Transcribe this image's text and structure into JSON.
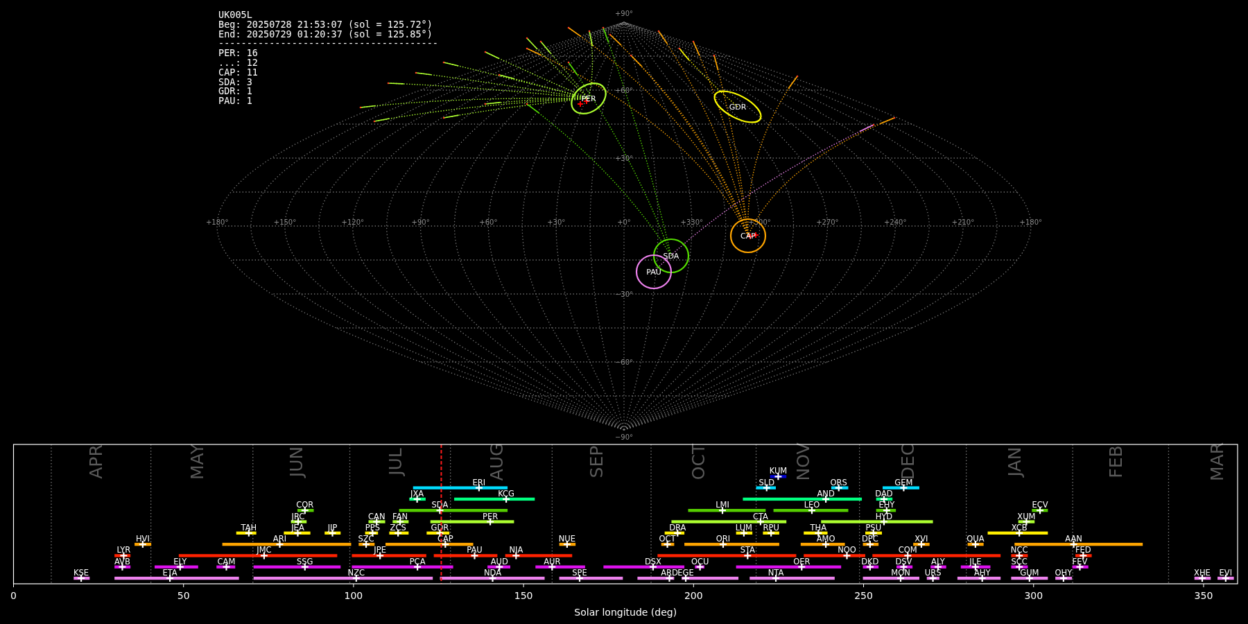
{
  "summary": {
    "station": "UK005L",
    "begin": "Beg: 20250728 21:53:07 (sol = 125.72°)",
    "end": "End: 20250729 01:20:37 (sol = 125.85°)",
    "separator": "---------------------------------------",
    "shower_counts": [
      "PER: 16",
      "...: 12",
      "CAP: 11",
      "SDA: 3",
      "GDR: 1",
      "PAU: 1"
    ]
  },
  "sky_map": {
    "lat_labels": [
      "+90°",
      "+60°",
      "+30°",
      "−30°",
      "−60°",
      "−90°"
    ],
    "lon_labels": [
      "+180°",
      "+150°",
      "+120°",
      "+90°",
      "+60°",
      "+30°",
      "+0°",
      "+330°",
      "+300°",
      "+270°",
      "+240°",
      "+210°",
      "+180°"
    ],
    "radiants": [
      {
        "label": "PER",
        "color": "#adff2f"
      },
      {
        "label": "GDR",
        "color": "#ffff00"
      },
      {
        "label": "CAP",
        "color": "#ffa500"
      },
      {
        "label": "SDA",
        "color": "#55dd00"
      },
      {
        "label": "PAU",
        "color": "#ee82ee"
      }
    ]
  },
  "activity_chart": {
    "months": [
      "APR",
      "MAY",
      "JUN",
      "JUL",
      "AUG",
      "SEP",
      "OCT",
      "NOV",
      "DEC",
      "JAN",
      "FEB",
      "MAR"
    ],
    "x_tick_labels": [
      "0",
      "50",
      "100",
      "150",
      "200",
      "250",
      "300",
      "350"
    ],
    "x_axis_title": "Solar longitude (deg)",
    "lanes": [
      {
        "color": "#0000cd",
        "showers": [
          "KUM"
        ]
      },
      {
        "color": "#00ddff",
        "showers": [
          "ERI",
          "SLD",
          "ORS",
          "GEM"
        ]
      },
      {
        "color": "#00ff7f",
        "showers": [
          "JXA",
          "KCG",
          "AND",
          "DAD"
        ]
      },
      {
        "color": "#55cc00",
        "showers": [
          "COR",
          "SDA",
          "LMI",
          "LEO",
          "EHY",
          "ECV"
        ]
      },
      {
        "color": "#adff2f",
        "showers": [
          "JRC",
          "CAN",
          "FAN",
          "PER",
          "CTA",
          "HYD",
          "XUM"
        ]
      },
      {
        "color": "#ffee00",
        "showers": [
          "TAH",
          "JEA",
          "JIP",
          "PPS",
          "ZCS",
          "GDR",
          "DRA",
          "LUM",
          "RPU",
          "THA",
          "PSU",
          "XCB"
        ]
      },
      {
        "color": "#ffa500",
        "showers": [
          "HVI",
          "ARI",
          "SZC",
          "CAP",
          "NUE",
          "OCT",
          "ORI",
          "AMO",
          "DPC",
          "XVI",
          "QUA",
          "AAN"
        ]
      },
      {
        "color": "#ff2200",
        "showers": [
          "LYR",
          "JMC",
          "JPE",
          "PAU",
          "NIA",
          "STA",
          "NOO",
          "COM",
          "NCC",
          "FED"
        ]
      },
      {
        "color": "#dd11ee",
        "showers": [
          "AVB",
          "ELY",
          "CAM",
          "SSG",
          "PCA",
          "AUD",
          "AUR",
          "DSX",
          "OCU",
          "OER",
          "DKD",
          "DSV",
          "ALY",
          "JLE",
          "SCC",
          "FEV"
        ]
      },
      {
        "color": "#ee82ee",
        "showers": [
          "KSE",
          "ETA",
          "NZC",
          "NDA",
          "SPE",
          "ARD",
          "EGE",
          "NTA",
          "MON",
          "URS",
          "AHY",
          "GUM",
          "OHY",
          "XHE",
          "EVI"
        ]
      }
    ]
  }
}
